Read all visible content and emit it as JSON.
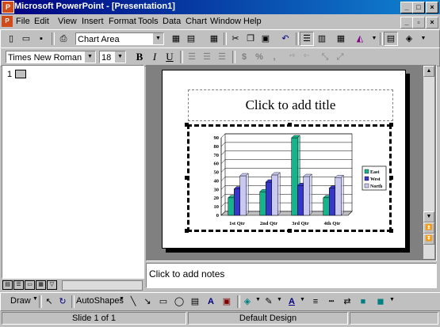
{
  "window": {
    "title": "Microsoft PowerPoint - [Presentation1]",
    "caption_buttons": [
      "minimize",
      "maximize",
      "close"
    ]
  },
  "menu": [
    "File",
    "Edit",
    "View",
    "Insert",
    "Format",
    "Tools",
    "Data",
    "Chart",
    "Window",
    "Help"
  ],
  "toolbar_standard": {
    "object_combo": "Chart Area",
    "icons": [
      "new-icon",
      "open-icon",
      "save-icon",
      "print-icon",
      "format-object-icon",
      "import-file-icon",
      "cut-icon",
      "copy-icon",
      "paste-icon",
      "undo-icon",
      "by-row-icon",
      "by-column-icon",
      "data-table-icon",
      "chart-type-icon",
      "legend-icon",
      "fill-color-icon"
    ]
  },
  "toolbar_formatting": {
    "font_name": "Times New Roman",
    "font_size": "18",
    "bold": "B",
    "italic": "I",
    "underline": "U"
  },
  "outline": {
    "slide_number": "1"
  },
  "slide": {
    "title_placeholder": "Click to add title"
  },
  "chart_data": {
    "type": "bar",
    "categories": [
      "1st Qtr",
      "2nd Qtr",
      "3rd Qtr",
      "4th Qtr"
    ],
    "series": [
      {
        "name": "East",
        "values": [
          20.4,
          27.4,
          90,
          20.4
        ],
        "color": "#17b38a"
      },
      {
        "name": "West",
        "values": [
          30.6,
          38.6,
          34.6,
          31.6
        ],
        "color": "#3838c8"
      },
      {
        "name": "North",
        "values": [
          45.9,
          46.9,
          45,
          43.9
        ],
        "color": "#c8c8f0"
      }
    ],
    "ylim": [
      0,
      90
    ],
    "yticks": [
      "0",
      "10",
      "20",
      "30",
      "40",
      "50",
      "60",
      "70",
      "80",
      "90"
    ],
    "grid": true,
    "legend": "right",
    "title": "",
    "xlabel": "",
    "ylabel": ""
  },
  "notes": {
    "placeholder": "Click to add notes"
  },
  "drawing": {
    "draw_label": "Draw",
    "autoshapes_label": "AutoShapes"
  },
  "status": {
    "slide": "Slide 1 of 1",
    "design": "Default Design"
  }
}
